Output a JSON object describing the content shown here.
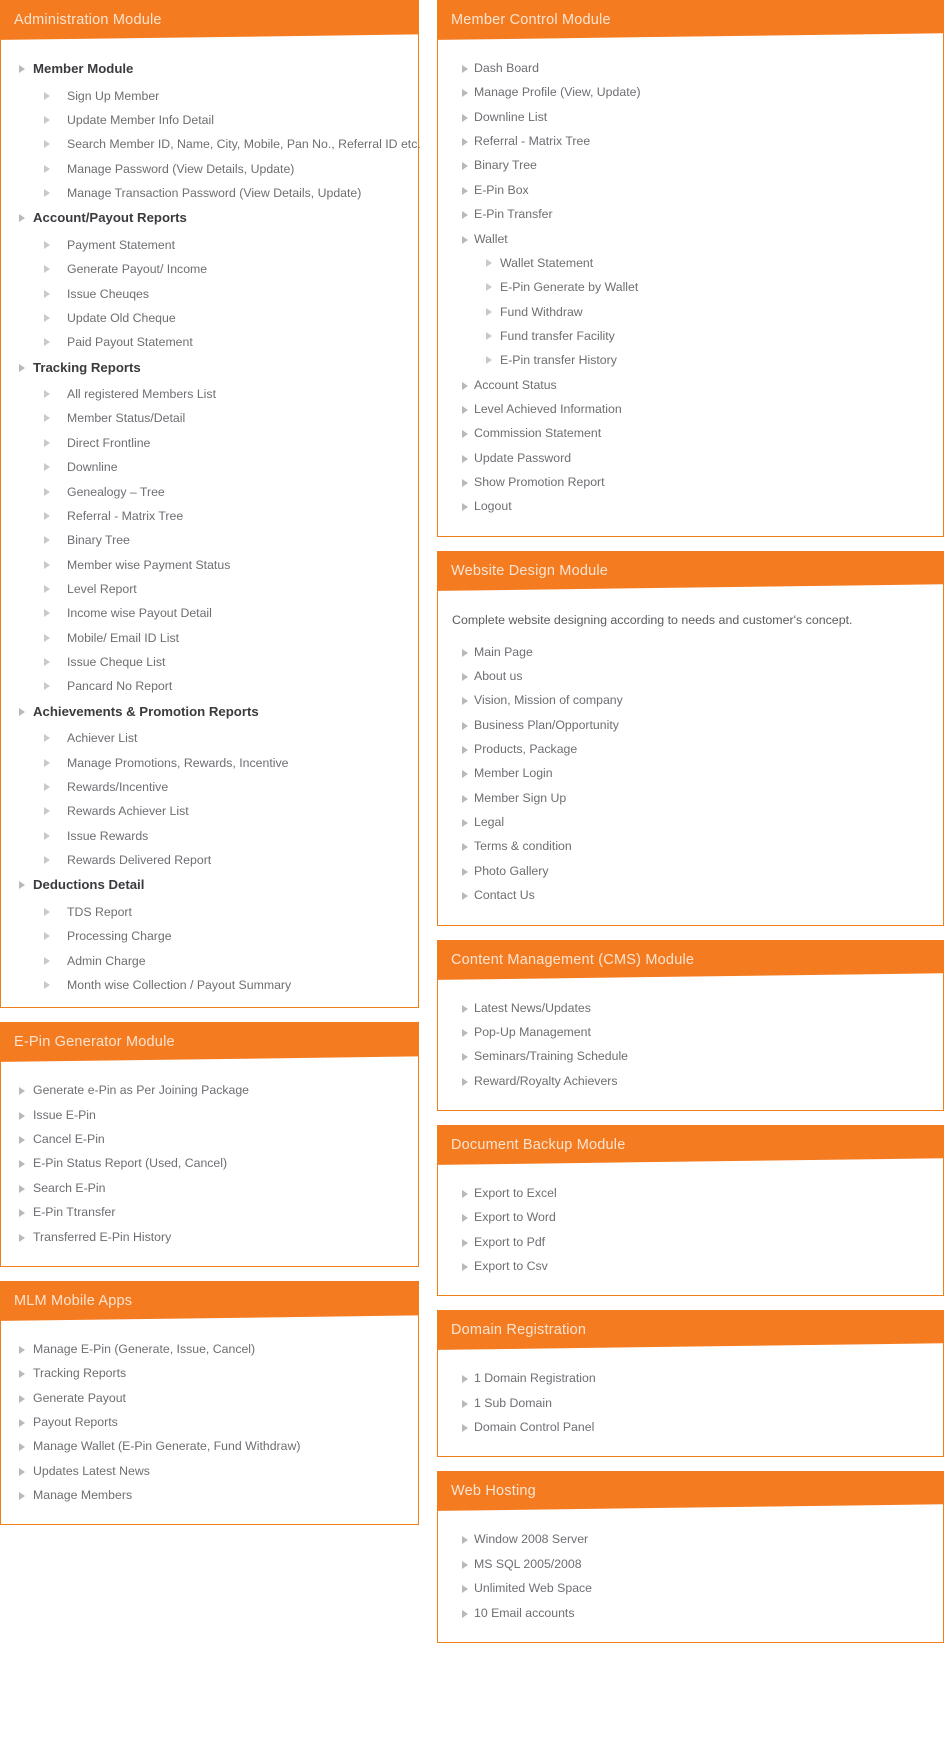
{
  "theme": {
    "accent": "#F47B20",
    "border": "#F07F1A",
    "header_text": "#FBE4D2",
    "item_text": "#6e6e73",
    "heading_text": "#3b3b3f"
  },
  "left_column": [
    {
      "title": "Administration Module",
      "items": [
        {
          "level": 0,
          "label": "Member Module"
        },
        {
          "level": 1,
          "label": "Sign Up Member"
        },
        {
          "level": 1,
          "label": "Update Member Info Detail"
        },
        {
          "level": 1,
          "label": "Search Member ID, Name, City, Mobile, Pan No., Referral ID etc."
        },
        {
          "level": 1,
          "label": "Manage Password (View Details, Update)"
        },
        {
          "level": 1,
          "label": "Manage Transaction Password (View Details, Update)"
        },
        {
          "level": 0,
          "label": "Account/Payout Reports"
        },
        {
          "level": 1,
          "label": "Payment Statement"
        },
        {
          "level": 1,
          "label": "Generate Payout/ Income"
        },
        {
          "level": 1,
          "label": "Issue Cheuqes"
        },
        {
          "level": 1,
          "label": "Update Old Cheque"
        },
        {
          "level": 1,
          "label": "Paid Payout Statement"
        },
        {
          "level": 0,
          "label": "Tracking Reports"
        },
        {
          "level": 1,
          "label": "All registered Members List"
        },
        {
          "level": 1,
          "label": "Member Status/Detail"
        },
        {
          "level": 1,
          "label": "Direct Frontline"
        },
        {
          "level": 1,
          "label": "Downline"
        },
        {
          "level": 1,
          "label": "Genealogy – Tree"
        },
        {
          "level": 1,
          "label": "Referral - Matrix Tree"
        },
        {
          "level": 1,
          "label": "Binary Tree"
        },
        {
          "level": 1,
          "label": "Member wise Payment Status"
        },
        {
          "level": 1,
          "label": "Level Report"
        },
        {
          "level": 1,
          "label": "Income wise Payout Detail"
        },
        {
          "level": 1,
          "label": "Mobile/ Email ID List"
        },
        {
          "level": 1,
          "label": "Issue Cheque List"
        },
        {
          "level": 1,
          "label": "Pancard No Report"
        },
        {
          "level": 0,
          "label": "Achievements & Promotion Reports"
        },
        {
          "level": 1,
          "label": "Achiever List"
        },
        {
          "level": 1,
          "label": "Manage Promotions, Rewards, Incentive"
        },
        {
          "level": 1,
          "label": "Rewards/Incentive"
        },
        {
          "level": 1,
          "label": "Rewards Achiever List"
        },
        {
          "level": 1,
          "label": "Issue Rewards"
        },
        {
          "level": 1,
          "label": "Rewards Delivered Report"
        },
        {
          "level": 0,
          "label": "Deductions Detail"
        },
        {
          "level": 1,
          "label": "TDS Report"
        },
        {
          "level": 1,
          "label": "Processing Charge"
        },
        {
          "level": 1,
          "label": "Admin Charge"
        },
        {
          "level": 1,
          "label": "Month wise Collection / Payout Summary"
        }
      ]
    },
    {
      "title": "E-Pin Generator Module",
      "items": [
        {
          "level": 0,
          "label": "Generate e-Pin as Per Joining Package",
          "plain": true
        },
        {
          "level": 0,
          "label": "Issue E-Pin",
          "plain": true
        },
        {
          "level": 0,
          "label": "Cancel E-Pin",
          "plain": true
        },
        {
          "level": 0,
          "label": "E-Pin Status Report (Used, Cancel)",
          "plain": true
        },
        {
          "level": 0,
          "label": "Search E-Pin",
          "plain": true
        },
        {
          "level": 0,
          "label": "E-Pin Ttransfer",
          "plain": true
        },
        {
          "level": 0,
          "label": "Transferred E-Pin History",
          "plain": true
        }
      ]
    },
    {
      "title": "MLM Mobile Apps",
      "items": [
        {
          "level": 0,
          "label": "Manage E-Pin (Generate, Issue, Cancel)",
          "plain": true
        },
        {
          "level": 0,
          "label": "Tracking Reports",
          "plain": true
        },
        {
          "level": 0,
          "label": "Generate Payout",
          "plain": true
        },
        {
          "level": 0,
          "label": "Payout Reports",
          "plain": true
        },
        {
          "level": 0,
          "label": "Manage Wallet (E-Pin Generate, Fund Withdraw)",
          "plain": true
        },
        {
          "level": 0,
          "label": "Updates Latest News",
          "plain": true
        },
        {
          "level": 0,
          "label": "Manage Members",
          "plain": true
        }
      ]
    }
  ],
  "right_column": [
    {
      "title": "Member Control Module",
      "items": [
        {
          "level": 0,
          "label": "Dash Board",
          "plain": true
        },
        {
          "level": 0,
          "label": "Manage Profile (View, Update)",
          "plain": true
        },
        {
          "level": 0,
          "label": "Downline List",
          "plain": true
        },
        {
          "level": 0,
          "label": "Referral - Matrix Tree",
          "plain": true
        },
        {
          "level": 0,
          "label": "Binary Tree",
          "plain": true
        },
        {
          "level": 0,
          "label": "E-Pin Box",
          "plain": true
        },
        {
          "level": 0,
          "label": "E-Pin Transfer",
          "plain": true
        },
        {
          "level": 0,
          "label": "Wallet",
          "plain": true
        },
        {
          "level": 2,
          "label": "Wallet Statement"
        },
        {
          "level": 2,
          "label": "E-Pin Generate by Wallet"
        },
        {
          "level": 2,
          "label": "Fund Withdraw"
        },
        {
          "level": 2,
          "label": "Fund transfer Facility"
        },
        {
          "level": 2,
          "label": "E-Pin transfer History"
        },
        {
          "level": 0,
          "label": "Account Status",
          "plain": true
        },
        {
          "level": 0,
          "label": "Level Achieved Information",
          "plain": true
        },
        {
          "level": 0,
          "label": "Commission Statement",
          "plain": true
        },
        {
          "level": 0,
          "label": "Update Password",
          "plain": true
        },
        {
          "level": 0,
          "label": "Show Promotion Report",
          "plain": true
        },
        {
          "level": 0,
          "label": "Logout",
          "plain": true
        }
      ]
    },
    {
      "title": "Website Design Module",
      "intro": "Complete website designing according to needs and customer's concept.",
      "items": [
        {
          "level": 0,
          "label": "Main Page",
          "plain": true
        },
        {
          "level": 0,
          "label": "About us",
          "plain": true
        },
        {
          "level": 0,
          "label": "Vision, Mission of company",
          "plain": true
        },
        {
          "level": 0,
          "label": "Business Plan/Opportunity",
          "plain": true
        },
        {
          "level": 0,
          "label": "Products, Package",
          "plain": true
        },
        {
          "level": 0,
          "label": "Member Login",
          "plain": true
        },
        {
          "level": 0,
          "label": "Member Sign Up",
          "plain": true
        },
        {
          "level": 0,
          "label": "Legal",
          "plain": true
        },
        {
          "level": 0,
          "label": "Terms & condition",
          "plain": true
        },
        {
          "level": 0,
          "label": "Photo Gallery",
          "plain": true
        },
        {
          "level": 0,
          "label": "Contact Us",
          "plain": true
        }
      ]
    },
    {
      "title": "Content Management (CMS) Module",
      "items": [
        {
          "level": 0,
          "label": "Latest News/Updates",
          "plain": true
        },
        {
          "level": 0,
          "label": "Pop-Up Management",
          "plain": true
        },
        {
          "level": 0,
          "label": "Seminars/Training Schedule",
          "plain": true
        },
        {
          "level": 0,
          "label": "Reward/Royalty Achievers",
          "plain": true
        }
      ]
    },
    {
      "title": "Document Backup Module",
      "items": [
        {
          "level": 0,
          "label": "Export to Excel",
          "plain": true
        },
        {
          "level": 0,
          "label": "Export to Word",
          "plain": true
        },
        {
          "level": 0,
          "label": "Export to Pdf",
          "plain": true
        },
        {
          "level": 0,
          "label": "Export to Csv",
          "plain": true
        }
      ]
    },
    {
      "title": "Domain Registration",
      "items": [
        {
          "level": 0,
          "label": "1 Domain Registration",
          "plain": true
        },
        {
          "level": 0,
          "label": "1 Sub Domain",
          "plain": true
        },
        {
          "level": 0,
          "label": "Domain Control Panel",
          "plain": true
        }
      ]
    },
    {
      "title": "Web Hosting",
      "items": [
        {
          "level": 0,
          "label": "Window 2008 Server",
          "plain": true
        },
        {
          "level": 0,
          "label": "MS SQL 2005/2008",
          "plain": true
        },
        {
          "level": 0,
          "label": "Unlimited Web Space",
          "plain": true
        },
        {
          "level": 0,
          "label": "10 Email accounts",
          "plain": true
        }
      ]
    }
  ]
}
